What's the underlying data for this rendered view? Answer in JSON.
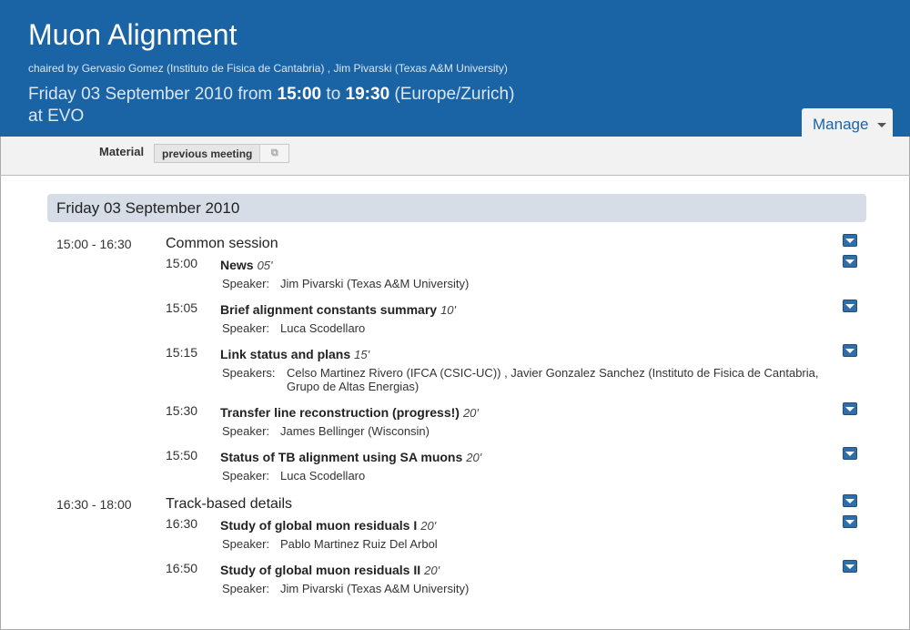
{
  "header": {
    "title": "Muon Alignment",
    "chairs": "chaired by Gervasio Gomez (Instituto de Fisica de Cantabria) , Jim Pivarski (Texas A&M University)",
    "date_prefix": "Friday 03 September 2010 from ",
    "start": "15:00",
    "to": " to ",
    "end": "19:30",
    "tz": " (Europe/Zurich)",
    "location": "at EVO",
    "manage_label": "Manage"
  },
  "material": {
    "label": "Material",
    "button": "previous meeting"
  },
  "day": {
    "label": "Friday 03 September 2010"
  },
  "sessions": [
    {
      "time": "15:00 - 16:30",
      "title": "Common session",
      "contributions": [
        {
          "time": "15:00",
          "title": "News",
          "dur": "05'",
          "speaker_label": "Speaker:",
          "speaker": "Jim Pivarski (Texas A&M University)"
        },
        {
          "time": "15:05",
          "title": "Brief alignment constants summary",
          "dur": "10'",
          "speaker_label": "Speaker:",
          "speaker": "Luca Scodellaro"
        },
        {
          "time": "15:15",
          "title": "Link status and plans",
          "dur": "15'",
          "speaker_label": "Speakers:",
          "speaker": "Celso Martinez Rivero (IFCA (CSIC-UC)) , Javier Gonzalez Sanchez (Instituto de Fisica de Cantabria, Grupo de Altas Energias)"
        },
        {
          "time": "15:30",
          "title": "Transfer line reconstruction (progress!)",
          "dur": "20'",
          "speaker_label": "Speaker:",
          "speaker": "James Bellinger (Wisconsin)"
        },
        {
          "time": "15:50",
          "title": "Status of TB alignment using SA muons",
          "dur": "20'",
          "speaker_label": "Speaker:",
          "speaker": "Luca Scodellaro"
        }
      ]
    },
    {
      "time": "16:30 - 18:00",
      "title": "Track-based details",
      "contributions": [
        {
          "time": "16:30",
          "title": "Study of global muon residuals I",
          "dur": "20'",
          "speaker_label": "Speaker:",
          "speaker": "Pablo Martinez Ruiz Del Arbol"
        },
        {
          "time": "16:50",
          "title": "Study of global muon residuals II",
          "dur": "20'",
          "speaker_label": "Speaker:",
          "speaker": "Jim Pivarski (Texas A&M University)"
        }
      ]
    }
  ]
}
